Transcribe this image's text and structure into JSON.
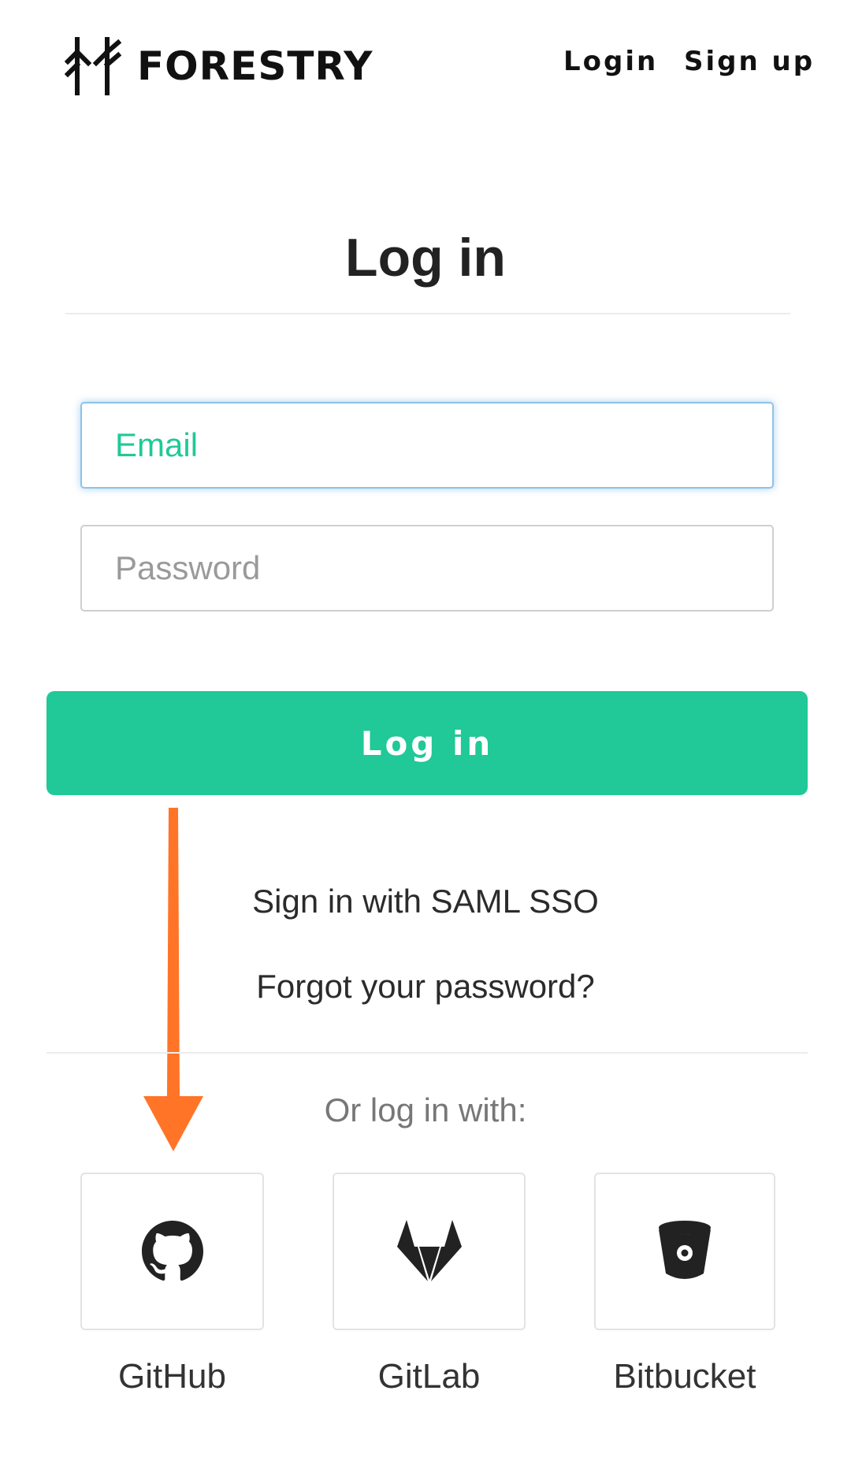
{
  "header": {
    "brand": "FORESTRY",
    "nav": {
      "login": "Login",
      "signup": "Sign up"
    }
  },
  "form": {
    "title": "Log in",
    "email_placeholder": "Email",
    "password_placeholder": "Password",
    "submit_label": "Log in"
  },
  "links": {
    "saml": "Sign in with SAML SSO",
    "forgot": "Forgot your password?"
  },
  "alt_login": {
    "heading": "Or log in with:",
    "providers": [
      {
        "label": "GitHub",
        "icon": "github-icon"
      },
      {
        "label": "GitLab",
        "icon": "gitlab-icon"
      },
      {
        "label": "Bitbucket",
        "icon": "bitbucket-icon"
      }
    ]
  },
  "annotation": {
    "icon": "arrow-down-icon",
    "color": "#ff7427"
  },
  "colors": {
    "accent": "#20c997",
    "focus_border": "#8ec3e6",
    "text": "#2b2b2b"
  }
}
